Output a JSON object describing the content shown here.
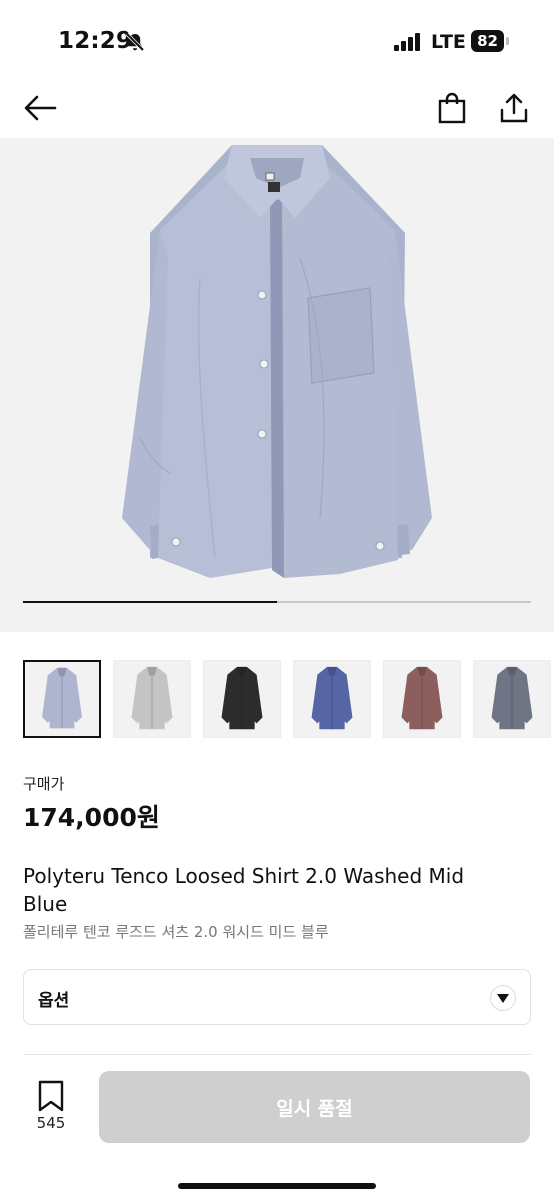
{
  "status_bar": {
    "time": "12:29",
    "network": "LTE",
    "battery": "82",
    "icons": [
      "bell-slash-icon",
      "signal-icon"
    ]
  },
  "nav": {
    "back_icon": "arrow-left-icon",
    "bag_icon": "shopping-bag-icon",
    "share_icon": "share-icon"
  },
  "gallery": {
    "progress": 0.5,
    "thumbnails": [
      {
        "color": "#aeb6cf",
        "selected": true
      },
      {
        "color": "#c4c4c4",
        "selected": false
      },
      {
        "color": "#2c2c2c",
        "selected": false
      },
      {
        "color": "#5565a6",
        "selected": false
      },
      {
        "color": "#8c5f5e",
        "selected": false
      },
      {
        "color": "#6f7585",
        "selected": false
      }
    ]
  },
  "product": {
    "price_label": "구매가",
    "price": "174,000원",
    "name_en": "Polyteru Tenco Loosed Shirt 2.0 Washed Mid Blue",
    "name_kr": "폴리테루 텐코 루즈드 셔츠 2.0 워시드 미드 블루"
  },
  "options": {
    "label": "옵션"
  },
  "bottom_bar": {
    "bookmark_count": "545",
    "buy_label": "일시 품절"
  },
  "colors": {
    "shirt": "#b3bbd3",
    "shirt_shadow": "#9aa3bf",
    "button_disabled": "#cfcfcf"
  }
}
